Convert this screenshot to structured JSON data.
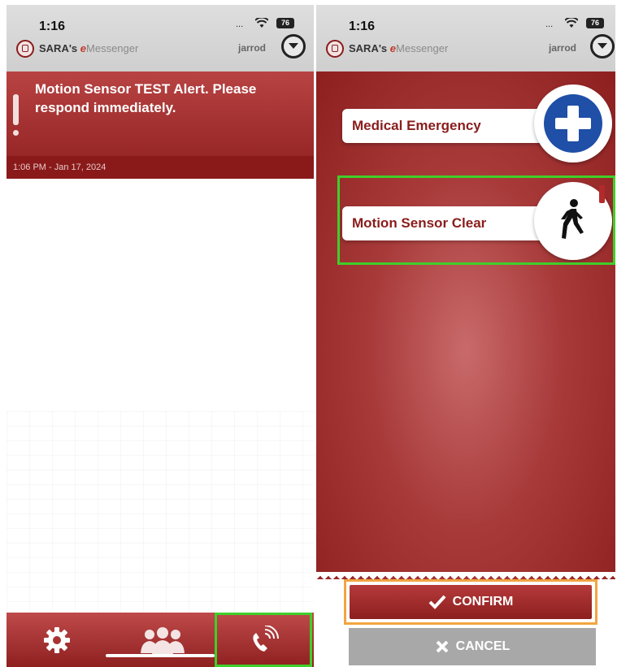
{
  "status_bar": {
    "time": "1:16",
    "signal": "...",
    "wifi": "ᯤ",
    "battery": "76"
  },
  "app": {
    "name_prefix": "SARA's ",
    "name_e": "e",
    "name_suffix": "Messenger",
    "user": "jarrod"
  },
  "alert": {
    "message": "Motion Sensor TEST Alert. Please respond immediately.",
    "timestamp": "1:06 PM - Jan 17, 2024"
  },
  "tabbar": {
    "items": [
      {
        "name": "settings",
        "icon": "gear-icon"
      },
      {
        "name": "contacts",
        "icon": "people-icon"
      },
      {
        "name": "call",
        "icon": "phone-signal-icon"
      }
    ]
  },
  "response_options": [
    {
      "label": "Medical Emergency",
      "icon": "medical-cross-icon",
      "icon_color": "#1f4fa6"
    },
    {
      "label": "Motion Sensor Clear",
      "icon": "walking-person-icon"
    }
  ],
  "actions": {
    "confirm_label": "CONFIRM",
    "cancel_label": "CANCEL"
  },
  "colors": {
    "brand_red": "#8d1f1f",
    "highlight_green": "#3fcf2a",
    "focus_orange": "#f2a541"
  }
}
